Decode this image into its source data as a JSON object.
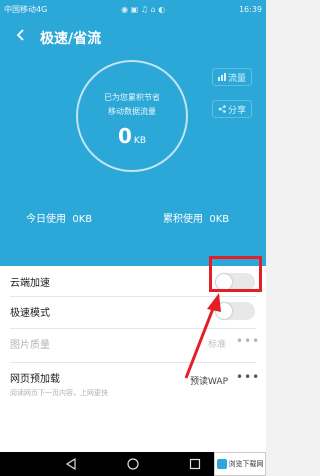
{
  "status_bar": {
    "carrier": "中国移动4G",
    "icons": "◉ ▣ ♫ ⌂ ◐",
    "time": "16:39"
  },
  "header": {
    "title": "极速/省流",
    "back_icon": "chevron-left-icon",
    "side_buttons": [
      {
        "label": "流量",
        "icon": "chart-icon"
      },
      {
        "label": "分享",
        "icon": "share-icon"
      }
    ],
    "circle": {
      "line1": "已为您累积节省",
      "line2": "移动数据流量",
      "value": "0",
      "unit": "KB"
    },
    "usage": {
      "today_label": "今日使用",
      "today_value": "0KB",
      "total_label": "累积使用",
      "total_value": "0KB"
    }
  },
  "settings": {
    "cloud_accel": {
      "label": "云端加速",
      "enabled": false
    },
    "turbo_mode": {
      "label": "极速模式",
      "enabled": false
    },
    "image_quality": {
      "label": "图片质量",
      "value": "标准",
      "more": "•••"
    },
    "page_preload": {
      "label": "网页预加载",
      "sub": "阅读网页下一页内容，上网更快",
      "value": "预读WAP",
      "more": "•••"
    }
  },
  "watermark": {
    "text": "浏览下载网"
  },
  "colors": {
    "primary": "#2ba7d8",
    "highlight": "#e31e24"
  }
}
